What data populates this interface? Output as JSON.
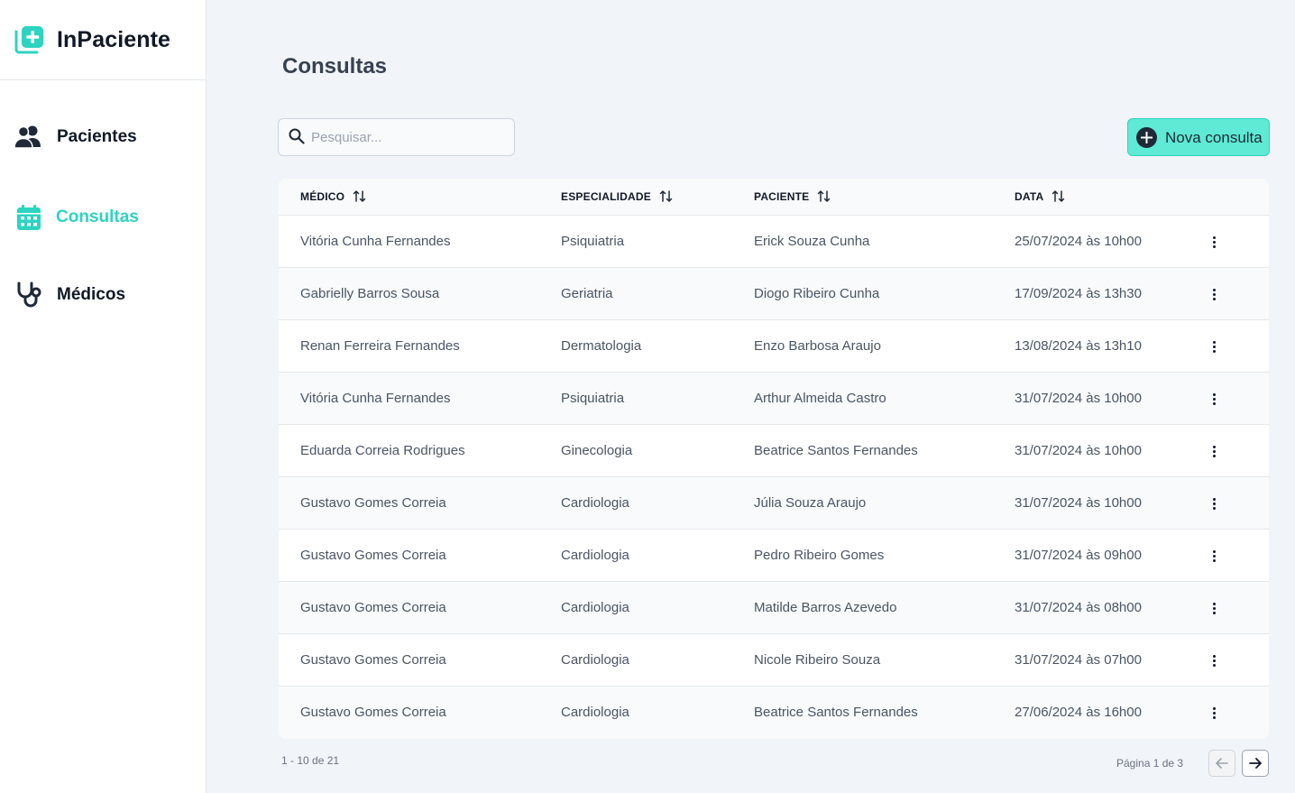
{
  "app": {
    "name": "InPaciente",
    "accent_color": "#2dd4bf",
    "button_color": "#5eead4"
  },
  "sidebar": {
    "items": [
      {
        "label": "Pacientes",
        "icon": "users-icon",
        "active": false
      },
      {
        "label": "Consultas",
        "icon": "calendar-icon",
        "active": true
      },
      {
        "label": "Médicos",
        "icon": "stethoscope-icon",
        "active": false
      }
    ]
  },
  "main": {
    "title": "Consultas",
    "search": {
      "placeholder": "Pesquisar...",
      "value": ""
    },
    "new_button": {
      "label": "Nova consulta",
      "icon": "plus-circle-icon"
    }
  },
  "table": {
    "columns": [
      "MÉDICO",
      "ESPECIALIDADE",
      "PACIENTE",
      "DATA"
    ],
    "rows": [
      [
        "Vitória Cunha Fernandes",
        "Psiquiatria",
        "Erick Souza Cunha",
        "25/07/2024 às 10h00"
      ],
      [
        "Gabrielly Barros Sousa",
        "Geriatria",
        "Diogo Ribeiro Cunha",
        "17/09/2024 às 13h30"
      ],
      [
        "Renan Ferreira Fernandes",
        "Dermatologia",
        "Enzo Barbosa Araujo",
        "13/08/2024 às 13h10"
      ],
      [
        "Vitória Cunha Fernandes",
        "Psiquiatria",
        "Arthur Almeida Castro",
        "31/07/2024 às 10h00"
      ],
      [
        "Eduarda Correia Rodrigues",
        "Ginecologia",
        "Beatrice Santos Fernandes",
        "31/07/2024 às 10h00"
      ],
      [
        "Gustavo Gomes Correia",
        "Cardiologia",
        "Júlia Souza Araujo",
        "31/07/2024 às 10h00"
      ],
      [
        "Gustavo Gomes Correia",
        "Cardiologia",
        "Pedro Ribeiro Gomes",
        "31/07/2024 às 09h00"
      ],
      [
        "Gustavo Gomes Correia",
        "Cardiologia",
        "Matilde Barros Azevedo",
        "31/07/2024 às 08h00"
      ],
      [
        "Gustavo Gomes Correia",
        "Cardiologia",
        "Nicole Ribeiro Souza",
        "31/07/2024 às 07h00"
      ],
      [
        "Gustavo Gomes Correia",
        "Cardiologia",
        "Beatrice Santos Fernandes",
        "27/06/2024 às 16h00"
      ]
    ]
  },
  "pagination": {
    "range": "1 - 10 de 21",
    "page": "Página 1 de 3"
  }
}
